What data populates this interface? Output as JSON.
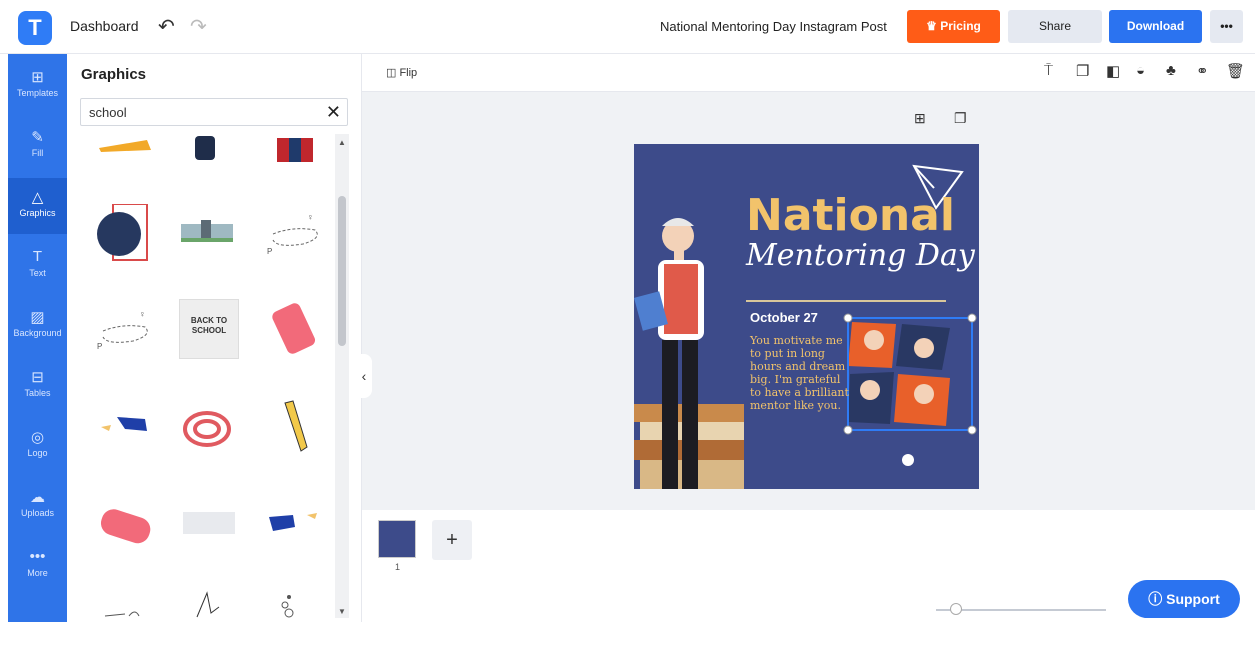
{
  "header": {
    "logo_letter": "T",
    "dashboard_label": "Dashboard",
    "undo_icon": "undo-icon",
    "redo_icon": "redo-icon",
    "document_title": "National Mentoring Day Instagram Post",
    "pricing_label": "Pricing",
    "share_label": "Share",
    "download_label": "Download",
    "more_label": "•••"
  },
  "rail": {
    "items": [
      {
        "label": "Templates",
        "icon": "templates-icon"
      },
      {
        "label": "Fill",
        "icon": "brush-icon"
      },
      {
        "label": "Graphics",
        "icon": "shapes-icon"
      },
      {
        "label": "Text",
        "icon": "text-icon"
      },
      {
        "label": "Background",
        "icon": "background-icon"
      },
      {
        "label": "Tables",
        "icon": "table-icon"
      },
      {
        "label": "Logo",
        "icon": "logo-icon"
      },
      {
        "label": "Uploads",
        "icon": "upload-icon"
      },
      {
        "label": "More",
        "icon": "more-icon"
      }
    ]
  },
  "panel": {
    "title": "Graphics",
    "search_value": "school",
    "tile_backtoschool_text": "BACK TO SCHOOL"
  },
  "toolbar": {
    "flip_label": "Flip"
  },
  "post": {
    "title_line1": "National",
    "title_line2": "Mentoring Day",
    "date": "October 27",
    "body": "You motivate me to put in long hours and dream big. I'm grateful to have a brilliant mentor like you."
  },
  "pages": {
    "page_number": "1",
    "add_label": "+"
  },
  "support": {
    "label": "Support"
  },
  "colors": {
    "accent": "#2f74e8",
    "pricing": "#ff5c17",
    "post_bg": "#3d4b8a",
    "title_gold": "#f2c36b"
  }
}
